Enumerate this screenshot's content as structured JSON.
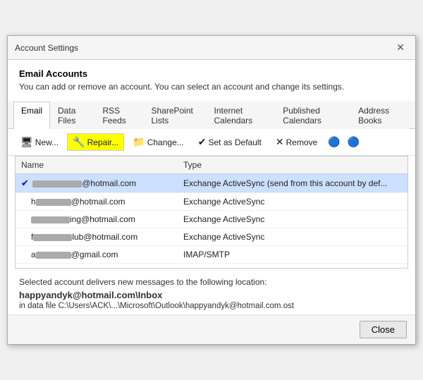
{
  "dialog": {
    "title": "Account Settings",
    "close_label": "✕"
  },
  "section": {
    "title": "Email Accounts",
    "description": "You can add or remove an account. You can select an account and change its settings."
  },
  "tabs": [
    {
      "label": "Email",
      "active": true
    },
    {
      "label": "Data Files",
      "active": false
    },
    {
      "label": "RSS Feeds",
      "active": false
    },
    {
      "label": "SharePoint Lists",
      "active": false
    },
    {
      "label": "Internet Calendars",
      "active": false
    },
    {
      "label": "Published Calendars",
      "active": false
    },
    {
      "label": "Address Books",
      "active": false
    }
  ],
  "toolbar": {
    "new_label": "New...",
    "repair_label": "Repair...",
    "change_label": "Change...",
    "default_label": "Set as Default",
    "remove_label": "Remove",
    "new_icon": "🖥",
    "repair_icon": "🔧",
    "change_icon": "📁",
    "default_icon": "✔",
    "remove_icon": "✕",
    "up_icon": "🔵",
    "down_icon": "🔵"
  },
  "table": {
    "headers": [
      "Name",
      "Type"
    ],
    "rows": [
      {
        "checked": true,
        "name_prefix": "",
        "name_blurred_width": "70",
        "name_suffix": "@hotmail.com",
        "type": "Exchange ActiveSync (send from this account by def...",
        "selected": true
      },
      {
        "checked": false,
        "name_prefix": "h",
        "name_blurred_width": "50",
        "name_suffix": "@hotmail.com",
        "type": "Exchange ActiveSync",
        "selected": false
      },
      {
        "checked": false,
        "name_prefix": "",
        "name_blurred_width": "55",
        "name_suffix": "ing@hotmail.com",
        "type": "Exchange ActiveSync",
        "selected": false
      },
      {
        "checked": false,
        "name_prefix": "f",
        "name_blurred_width": "55",
        "name_suffix": "lub@hotmail.com",
        "type": "Exchange ActiveSync",
        "selected": false
      },
      {
        "checked": false,
        "name_prefix": "a",
        "name_blurred_width": "50",
        "name_suffix": "@gmail.com",
        "type": "IMAP/SMTP",
        "selected": false
      }
    ]
  },
  "footer": {
    "description": "Selected account delivers new messages to the following location:",
    "location": "happyandyk@hotmail.com\\Inbox",
    "filepath": "in data file C:\\Users\\ACK\\...\\Microsoft\\Outlook\\happyandyk@hotmail.com.ost"
  },
  "close_button_label": "Close"
}
